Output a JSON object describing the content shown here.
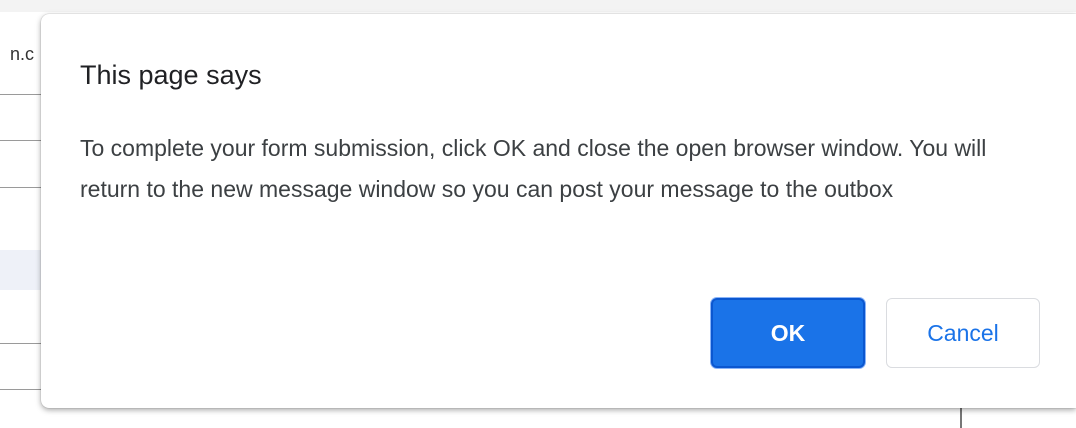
{
  "background": {
    "url_fragment": "n.c"
  },
  "dialog": {
    "title": "This page says",
    "message": "To complete your form submission, click OK and close the open browser window. You will return to the new message window so you can post your message to the outbox",
    "ok_label": "OK",
    "cancel_label": "Cancel"
  },
  "colors": {
    "primary": "#1a73e8",
    "dialog_background": "#ffffff",
    "text": "#202124"
  }
}
